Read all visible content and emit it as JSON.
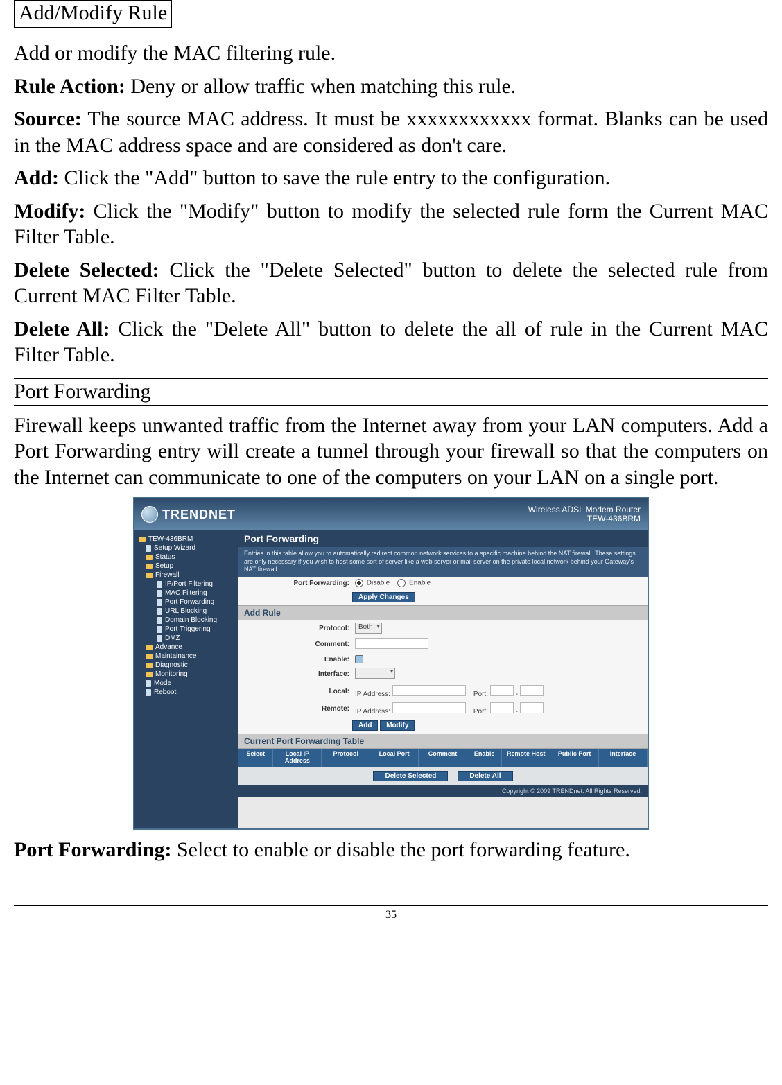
{
  "doc": {
    "boxed_heading": "Add/Modify Rule",
    "intro": "Add or modify the MAC filtering rule.",
    "rule_action_label": "Rule Action:",
    "rule_action_text": " Deny or allow traffic when matching this rule.",
    "source_label": "Source:",
    "source_text": " The source MAC address. It must be xxxxxxxxxxxx format. Blanks can be used in the MAC address space and are considered as don't care.",
    "add_label": "Add:",
    "add_text": " Click the \"Add\" button to save the rule entry to the configuration.",
    "modify_label": "Modify:",
    "modify_text": " Click the \"Modify\" button to modify the selected rule form the Current MAC Filter Table.",
    "delete_selected_label": "Delete Selected:",
    "delete_selected_text": " Click the \"Delete Selected\" button to delete the selected rule from Current MAC Filter Table.",
    "delete_all_label": "Delete All:",
    "delete_all_text": " Click the \"Delete All\" button to delete the all of rule in the Current MAC Filter Table.",
    "section_heading": "Port Forwarding",
    "port_fw_intro": "Firewall keeps unwanted traffic from the Internet away from your LAN computers. Add a Port Forwarding entry will create a tunnel through your firewall so that the computers on the Internet can communicate to one of the computers on your LAN on a single port.",
    "port_fw_label": "Port Forwarding:",
    "port_fw_text": " Select to enable or disable the port forwarding feature.",
    "page_number": "35"
  },
  "router": {
    "brand": "TRENDNET",
    "model_line1": "Wireless ADSL Modem Router",
    "model_line2": "TEW-436BRM",
    "sidebar_root": "TEW-436BRM",
    "sidebar": [
      [
        "file",
        "Setup Wizard",
        1
      ],
      [
        "folder",
        "Status",
        1
      ],
      [
        "folder",
        "Setup",
        1
      ],
      [
        "folder",
        "Firewall",
        1
      ],
      [
        "file",
        "IP/Port Filtering",
        2
      ],
      [
        "file",
        "MAC Filtering",
        2
      ],
      [
        "file",
        "Port Forwarding",
        2
      ],
      [
        "file",
        "URL Blocking",
        2
      ],
      [
        "file",
        "Domain Blocking",
        2
      ],
      [
        "file",
        "Port Triggering",
        2
      ],
      [
        "file",
        "DMZ",
        2
      ],
      [
        "folder",
        "Advance",
        1
      ],
      [
        "folder",
        "Maintainance",
        1
      ],
      [
        "folder",
        "Diagnostic",
        1
      ],
      [
        "folder",
        "Monitoring",
        1
      ],
      [
        "file",
        "Mode",
        1
      ],
      [
        "file",
        "Reboot",
        1
      ]
    ],
    "panel_title": "Port Forwarding",
    "panel_desc": "Entries in this table allow you to automatically redirect common network services to a specific machine behind the NAT firewall. These settings are only necessary if you wish to host some sort of server like a web server or mail server on the private local network behind your Gateway's NAT firewall.",
    "labels": {
      "port_forwarding": "Port Forwarding:",
      "disable": "Disable",
      "enable": "Enable",
      "apply_changes": "Apply Changes",
      "add_rule_header": "Add Rule",
      "protocol": "Protocol:",
      "protocol_value": "Both",
      "comment": "Comment:",
      "enable_row": "Enable:",
      "interface": "Interface:",
      "local": "Local:",
      "remote": "Remote:",
      "ip_address": "IP Address:",
      "port": "Port:",
      "port_sep": "-",
      "add_btn": "Add",
      "modify_btn": "Modify",
      "current_table_header": "Current Port Forwarding Table",
      "delete_selected": "Delete Selected",
      "delete_all": "Delete All"
    },
    "table_cols": [
      "Select",
      "Local IP Address",
      "Protocol",
      "Local Port",
      "Comment",
      "Enable",
      "Remote Host",
      "Public Port",
      "Interface"
    ],
    "copyright": "Copyright © 2009 TRENDnet. All Rights Reserved."
  }
}
